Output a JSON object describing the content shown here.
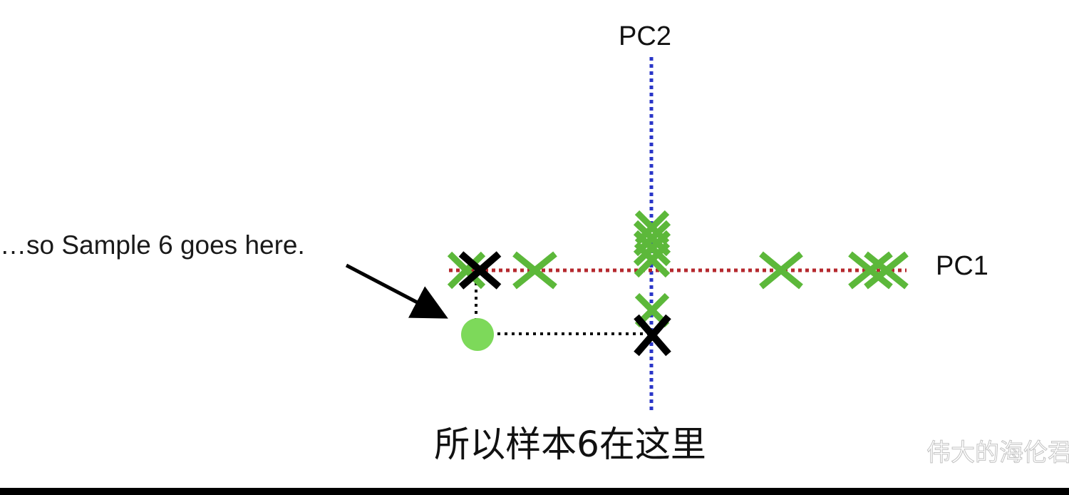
{
  "axes": {
    "pc1_label": "PC1",
    "pc2_label": "PC2",
    "pc1_color": "#b5282e",
    "pc2_color": "#2a36c8"
  },
  "callout": {
    "text": "…so Sample 6 goes here."
  },
  "subtitle": {
    "text": "所以样本6在这里"
  },
  "watermark": {
    "text": "伟大的海伦君"
  },
  "colors": {
    "green_mark": "#5cb83a",
    "green_dot": "#7dd95a",
    "black_mark": "#000000",
    "guide": "#000000"
  }
}
